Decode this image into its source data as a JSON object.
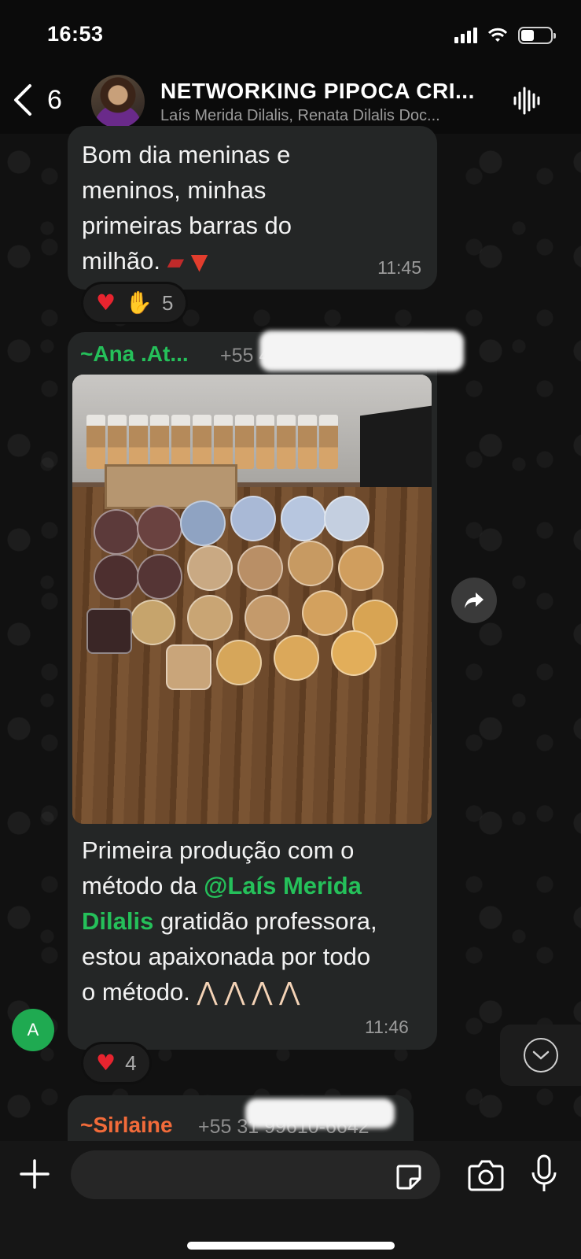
{
  "status_bar": {
    "time": "16:53"
  },
  "header": {
    "back_count": "6",
    "title": "NETWORKING PIPOCA CRI...",
    "members": "Laís Merida Dilalis, Renata Dilalis Doc..."
  },
  "messages": [
    {
      "text_lines": [
        "Bom dia meninas e",
        "meninos,  minhas",
        "primeiras  barras do",
        "milhão."
      ],
      "emojis": [
        "chocolate-bar",
        "popcorn"
      ],
      "time": "11:45",
      "reactions": {
        "emojis": [
          "heart",
          "clapping-hands"
        ],
        "count": "5"
      }
    },
    {
      "sender": "~Ana .At...",
      "sender_color": "#25c05a",
      "sender_phone": "+55 4",
      "photo": "popcorn-production",
      "text_lines": [
        "Primeira produção  com o",
        "método da "
      ],
      "mention": "@Laís Merida",
      "mention_line2": "Dilalis",
      "text_after_mention": " gratidão professora,",
      "text_lines_2": [
        "estou apaixonada  por todo",
        "o método."
      ],
      "emojis": [
        "folded-hands",
        "folded-hands",
        "folded-hands",
        "folded-hands"
      ],
      "time": "11:46",
      "reactions": {
        "emojis": [
          "heart"
        ],
        "count": "4"
      }
    },
    {
      "sender": "~Sirlaine",
      "sender_color": "#f26b3a",
      "sender_phone": "+55 31 99610-6642"
    }
  ],
  "member_avatar_letter": "A",
  "input": {
    "placeholder": ""
  },
  "colors": {
    "accent_green": "#25c05a",
    "bubble": "#242626",
    "background": "#0b0b0b"
  }
}
